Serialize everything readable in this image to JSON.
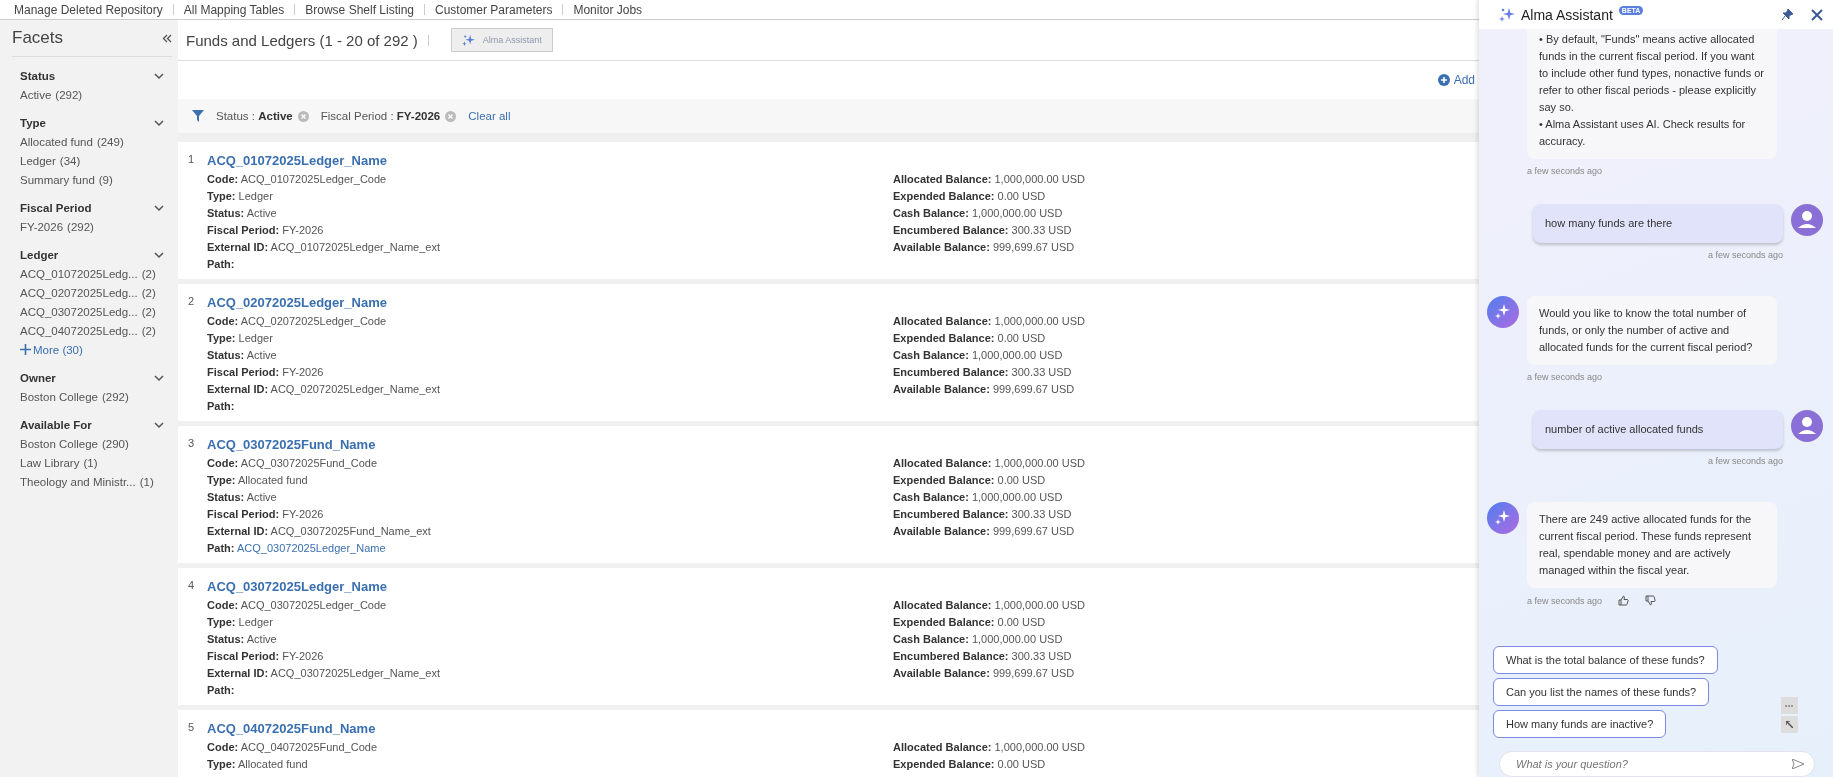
{
  "top_nav": [
    {
      "label": "Manage Deleted Repository"
    },
    {
      "label": "All Mapping Tables"
    },
    {
      "label": "Browse Shelf Listing"
    },
    {
      "label": "Customer Parameters"
    },
    {
      "label": "Monitor Jobs"
    }
  ],
  "facets": {
    "title": "Facets",
    "groups": [
      {
        "title": "Status",
        "expanded": true,
        "items": [
          {
            "label": "Active",
            "count": "(292)"
          }
        ]
      },
      {
        "title": "Type",
        "expanded": true,
        "items": [
          {
            "label": "Allocated fund",
            "count": "(249)"
          },
          {
            "label": "Ledger",
            "count": "(34)"
          },
          {
            "label": "Summary fund",
            "count": "(9)"
          }
        ]
      },
      {
        "title": "Fiscal Period",
        "expanded": true,
        "items": [
          {
            "label": "FY-2026",
            "count": "(292)"
          }
        ]
      },
      {
        "title": "Ledger",
        "expanded": true,
        "items": [
          {
            "label": "ACQ_01072025Ledg...",
            "count": "(2)"
          },
          {
            "label": "ACQ_02072025Ledg...",
            "count": "(2)"
          },
          {
            "label": "ACQ_03072025Ledg...",
            "count": "(2)"
          },
          {
            "label": "ACQ_04072025Ledg...",
            "count": "(2)"
          }
        ],
        "more": "More (30)"
      },
      {
        "title": "Owner",
        "expanded": true,
        "items": [
          {
            "label": "Boston College",
            "count": "(292)"
          }
        ]
      },
      {
        "title": "Available For",
        "expanded": true,
        "items": [
          {
            "label": "Boston College",
            "count": "(290)"
          },
          {
            "label": "Law Library",
            "count": "(1)"
          },
          {
            "label": "Theology and Ministr...",
            "count": "(1)"
          }
        ]
      }
    ]
  },
  "results": {
    "title": "Funds and Ledgers (1 - 20 of 292 )",
    "assistant_button": {
      "label": "Alma Assistant",
      "disabled": true
    },
    "add_link": "Add",
    "filters": [
      {
        "name": "Status :",
        "value": "Active"
      },
      {
        "name": "Fiscal Period :",
        "value": "FY-2026"
      }
    ],
    "clear_all": "Clear all",
    "rows": [
      {
        "number": "1",
        "name": "ACQ_01072025Ledger_Name",
        "fields": [
          {
            "label": "Code:",
            "value": "ACQ_01072025Ledger_Code",
            "kind": "text"
          },
          {
            "label": "Type:",
            "value": "Ledger",
            "kind": "text"
          },
          {
            "label": "Status:",
            "value": "Active",
            "kind": "text"
          },
          {
            "label": "Fiscal Period:",
            "value": "FY-2026",
            "kind": "text"
          },
          {
            "label": "External ID:",
            "value": "ACQ_01072025Ledger_Name_ext",
            "kind": "text"
          },
          {
            "label": "Path:",
            "kind": "text"
          }
        ],
        "balances": [
          {
            "label": "Allocated Balance:",
            "value": "1,000,000.00 USD"
          },
          {
            "label": "Expended Balance:",
            "value": "0.00 USD"
          },
          {
            "label": "Cash Balance:",
            "value": "1,000,000.00 USD"
          },
          {
            "label": "Encumbered Balance:",
            "value": "300.33 USD"
          },
          {
            "label": "Available Balance:",
            "value": "999,699.67 USD"
          }
        ]
      },
      {
        "number": "2",
        "name": "ACQ_02072025Ledger_Name",
        "fields": [
          {
            "label": "Code:",
            "value": "ACQ_02072025Ledger_Code",
            "kind": "text"
          },
          {
            "label": "Type:",
            "value": "Ledger",
            "kind": "text"
          },
          {
            "label": "Status:",
            "value": "Active",
            "kind": "text"
          },
          {
            "label": "Fiscal Period:",
            "value": "FY-2026",
            "kind": "text"
          },
          {
            "label": "External ID:",
            "value": "ACQ_02072025Ledger_Name_ext",
            "kind": "text"
          },
          {
            "label": "Path:",
            "kind": "text"
          }
        ],
        "balances": [
          {
            "label": "Allocated Balance:",
            "value": "1,000,000.00 USD"
          },
          {
            "label": "Expended Balance:",
            "value": "0.00 USD"
          },
          {
            "label": "Cash Balance:",
            "value": "1,000,000.00 USD"
          },
          {
            "label": "Encumbered Balance:",
            "value": "300.33 USD"
          },
          {
            "label": "Available Balance:",
            "value": "999,699.67 USD"
          }
        ]
      },
      {
        "number": "3",
        "name": "ACQ_03072025Fund_Name",
        "fields": [
          {
            "label": "Code:",
            "value": "ACQ_03072025Fund_Code",
            "kind": "text"
          },
          {
            "label": "Type:",
            "value": "Allocated fund",
            "kind": "text"
          },
          {
            "label": "Status:",
            "value": "Active",
            "kind": "text"
          },
          {
            "label": "Fiscal Period:",
            "value": "FY-2026",
            "kind": "text"
          },
          {
            "label": "External ID:",
            "value": "ACQ_03072025Fund_Name_ext",
            "kind": "text"
          },
          {
            "label": "Path:",
            "value": "ACQ_03072025Ledger_Name",
            "kind": "link"
          }
        ],
        "balances": [
          {
            "label": "Allocated Balance:",
            "value": "1,000,000.00 USD"
          },
          {
            "label": "Expended Balance:",
            "value": "0.00 USD"
          },
          {
            "label": "Cash Balance:",
            "value": "1,000,000.00 USD"
          },
          {
            "label": "Encumbered Balance:",
            "value": "300.33 USD"
          },
          {
            "label": "Available Balance:",
            "value": "999,699.67 USD"
          }
        ]
      },
      {
        "number": "4",
        "name": "ACQ_03072025Ledger_Name",
        "fields": [
          {
            "label": "Code:",
            "value": "ACQ_03072025Ledger_Code",
            "kind": "text"
          },
          {
            "label": "Type:",
            "value": "Ledger",
            "kind": "text"
          },
          {
            "label": "Status:",
            "value": "Active",
            "kind": "text"
          },
          {
            "label": "Fiscal Period:",
            "value": "FY-2026",
            "kind": "text"
          },
          {
            "label": "External ID:",
            "value": "ACQ_03072025Ledger_Name_ext",
            "kind": "text"
          },
          {
            "label": "Path:",
            "kind": "text"
          }
        ],
        "balances": [
          {
            "label": "Allocated Balance:",
            "value": "1,000,000.00 USD"
          },
          {
            "label": "Expended Balance:",
            "value": "0.00 USD"
          },
          {
            "label": "Cash Balance:",
            "value": "1,000,000.00 USD"
          },
          {
            "label": "Encumbered Balance:",
            "value": "300.33 USD"
          },
          {
            "label": "Available Balance:",
            "value": "999,699.67 USD"
          }
        ]
      },
      {
        "number": "5",
        "name": "ACQ_04072025Fund_Name",
        "fields": [
          {
            "label": "Code:",
            "value": "ACQ_04072025Fund_Code",
            "kind": "text"
          },
          {
            "label": "Type:",
            "value": "Allocated fund",
            "kind": "text"
          }
        ],
        "balances": [
          {
            "label": "Allocated Balance:",
            "value": "1,000,000.00 USD"
          },
          {
            "label": "Expended Balance:",
            "value": "0.00 USD"
          }
        ]
      }
    ]
  },
  "assistant": {
    "title": "Alma Assistant",
    "badge": "BETA",
    "messages": [
      {
        "kind": "bot",
        "avatar": false,
        "feedback": false,
        "lines": [
          "• By default, \"Funds\" means active allocated funds in the current fiscal period. If you want to include other fund types, nonactive funds or refer to other fiscal periods - please explicitly say so.",
          "• Alma Assistant uses AI. Check results for accuracy."
        ],
        "time": "a few seconds ago"
      },
      {
        "kind": "user",
        "avatar": true,
        "feedback": false,
        "lines": [
          "how many funds are there"
        ],
        "time": "a few seconds ago"
      },
      {
        "kind": "bot",
        "avatar": true,
        "feedback": false,
        "lines": [
          "Would you like to know the total number of funds, or only the number of active and allocated funds for the current fiscal period?"
        ],
        "time": "a few seconds ago"
      },
      {
        "kind": "user",
        "avatar": true,
        "feedback": false,
        "lines": [
          "number of active allocated funds"
        ],
        "time": "a few seconds ago"
      },
      {
        "kind": "bot",
        "avatar": true,
        "feedback": true,
        "lines": [
          "There are 249 active allocated funds for the current fiscal period. These funds represent real, spendable money and are actively managed within the fiscal year."
        ],
        "time": "a few seconds ago"
      }
    ],
    "suggestions": [
      "What is the total balance of these funds?",
      "Can you list the names of these funds?",
      "How many funds are inactive?"
    ],
    "input": {
      "placeholder": "What is your question?"
    }
  }
}
